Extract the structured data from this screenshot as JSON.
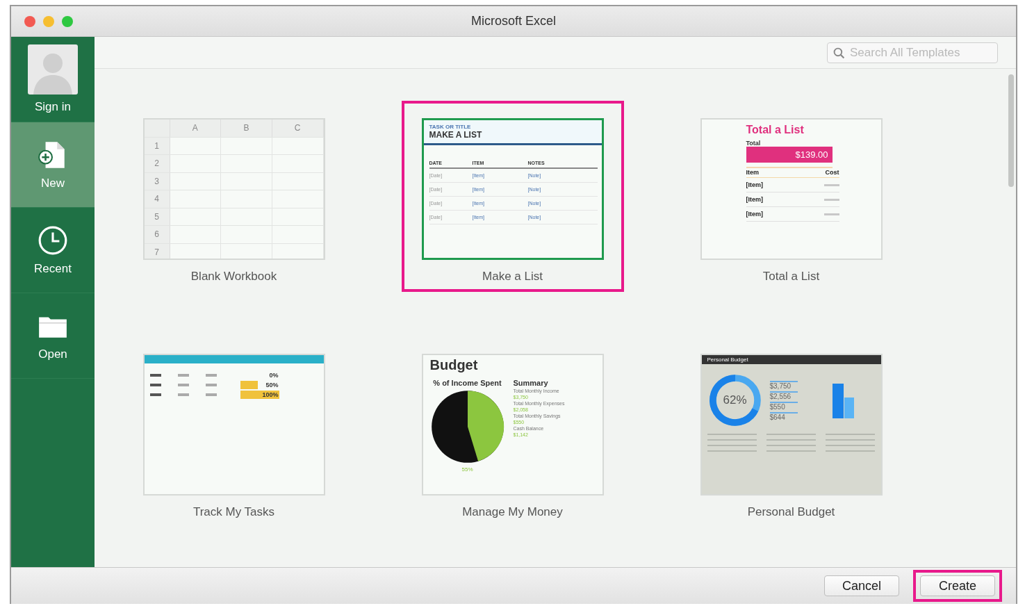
{
  "window": {
    "title": "Microsoft Excel"
  },
  "sidebar": {
    "items": [
      {
        "kind": "account",
        "label": "Sign in",
        "selected": false
      },
      {
        "kind": "new",
        "label": "New",
        "selected": true
      },
      {
        "kind": "recent",
        "label": "Recent",
        "selected": false
      },
      {
        "kind": "open",
        "label": "Open",
        "selected": false
      }
    ]
  },
  "search": {
    "placeholder": "Search All Templates"
  },
  "templates": [
    {
      "kind": "blank",
      "name": "Blank Workbook",
      "selected": false,
      "preview": {
        "columns": [
          "A",
          "B",
          "C"
        ],
        "rows": [
          "1",
          "2",
          "3",
          "4",
          "5",
          "6",
          "7"
        ]
      }
    },
    {
      "kind": "list",
      "name": "Make a List",
      "selected": true,
      "preview": {
        "subtitle": "TASK OR TITLE",
        "title": "MAKE A LIST",
        "columns": [
          "DATE",
          "ITEM",
          "NOTES"
        ],
        "rows": [
          [
            "[Date]",
            "[Item]",
            "[Note]"
          ],
          [
            "[Date]",
            "[Item]",
            "[Note]"
          ],
          [
            "[Date]",
            "[Item]",
            "[Note]"
          ],
          [
            "[Date]",
            "[Item]",
            "[Note]"
          ]
        ]
      }
    },
    {
      "kind": "total",
      "name": "Total a List",
      "selected": false,
      "preview": {
        "title": "Total a List",
        "total_label": "Total",
        "total": "$139.00",
        "columns": [
          "Item",
          "Cost"
        ],
        "rows": [
          "[Item]",
          "[Item]",
          "[Item]"
        ]
      }
    },
    {
      "kind": "tasks",
      "name": "Track My Tasks",
      "selected": false,
      "preview": {
        "rows": [
          {
            "percent": "0%"
          },
          {
            "percent": "50%"
          },
          {
            "percent": "100%"
          }
        ]
      }
    },
    {
      "kind": "budget",
      "name": "Manage My Money",
      "selected": false,
      "preview": {
        "title": "Budget",
        "chart_title": "% of Income Spent",
        "summary_title": "Summary",
        "summary": [
          {
            "label": "Total Monthly Income",
            "value": "$3,750"
          },
          {
            "label": "Total Monthly Expenses",
            "value": "$2,058"
          },
          {
            "label": "Total Monthly Savings",
            "value": "$550"
          },
          {
            "label": "Cash Balance",
            "value": "$1,142"
          }
        ],
        "percent": "55%"
      }
    },
    {
      "kind": "personal",
      "name": "Personal Budget",
      "selected": false,
      "preview": {
        "title": "Personal Budget",
        "percent": "62%",
        "amounts": [
          "$3,750",
          "$2,556",
          "$550",
          "$644"
        ]
      }
    }
  ],
  "buttons": [
    {
      "label": "Cancel",
      "highlighted": false
    },
    {
      "label": "Create",
      "highlighted": true
    }
  ]
}
